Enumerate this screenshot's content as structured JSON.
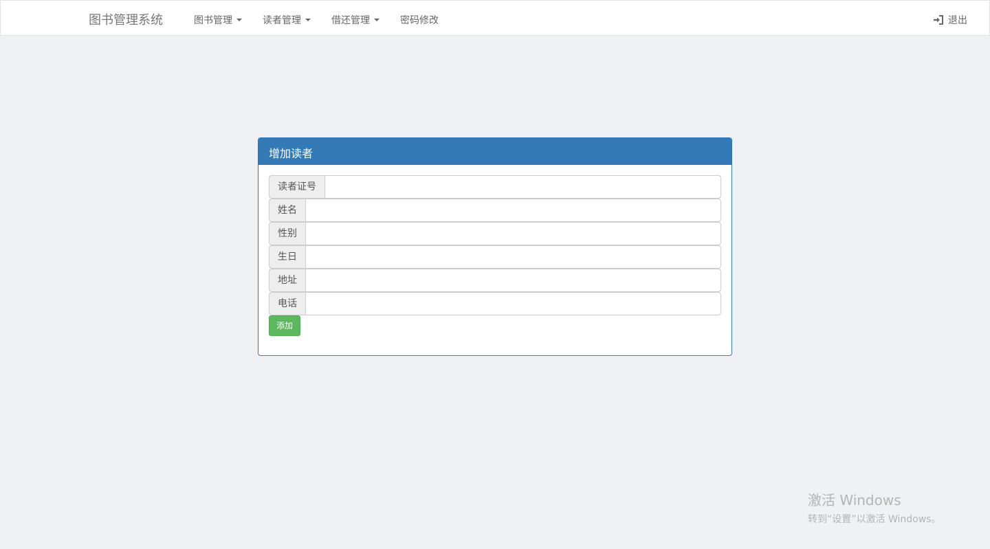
{
  "navbar": {
    "brand": "图书管理系统",
    "items": [
      {
        "label": "图书管理",
        "dropdown": true
      },
      {
        "label": "读者管理",
        "dropdown": true
      },
      {
        "label": "借还管理",
        "dropdown": true
      },
      {
        "label": "密码修改",
        "dropdown": false
      }
    ],
    "logout_label": "退出",
    "logout_icon": "login-icon"
  },
  "panel": {
    "title": "增加读者",
    "fields": [
      {
        "label": "读者证号",
        "value": ""
      },
      {
        "label": "姓名",
        "value": ""
      },
      {
        "label": "性别",
        "value": ""
      },
      {
        "label": "生日",
        "value": ""
      },
      {
        "label": "地址",
        "value": ""
      },
      {
        "label": "电话",
        "value": ""
      }
    ],
    "submit_label": "添加"
  },
  "watermark": {
    "title": "激活 Windows",
    "subtitle": "转到“设置”以激活 Windows。"
  },
  "colors": {
    "primary": "#337ab7",
    "success": "#5cb85c",
    "background": "#eff1f5"
  }
}
